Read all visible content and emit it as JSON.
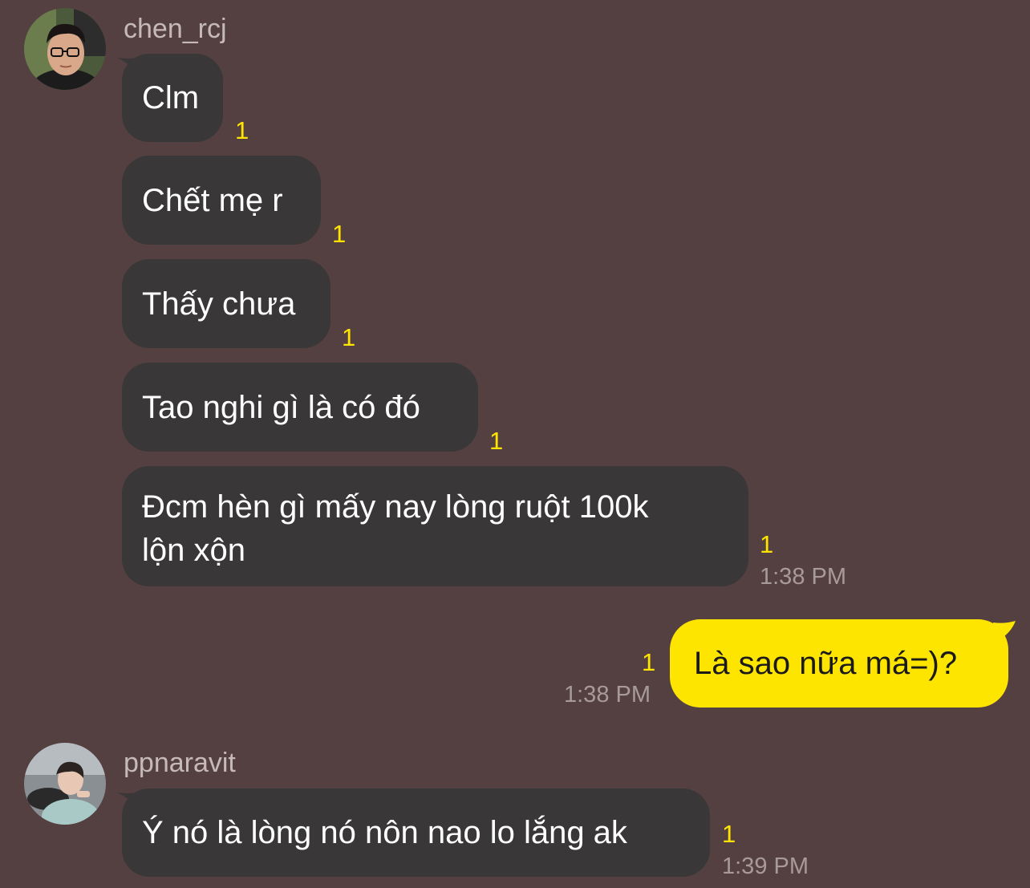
{
  "colors": {
    "background": "#544040",
    "incoming_bubble": "#393738",
    "outgoing_bubble": "#fee500",
    "unread_count": "#fee500"
  },
  "messages": {
    "group1": {
      "sender": "chen_rcj",
      "avatar_icon": "user-photo",
      "items": [
        {
          "text": "Clm",
          "unread": "1"
        },
        {
          "text": "Chết mẹ r",
          "unread": "1"
        },
        {
          "text": "Thấy chưa",
          "unread": "1"
        },
        {
          "text": "Tao nghi gì là có đó",
          "unread": "1"
        },
        {
          "text_line1": "Đcm hèn gì mấy nay lòng ruột 100k",
          "text_line2": "lộn xộn",
          "unread": "1",
          "time": "1:38 PM"
        }
      ]
    },
    "outgoing": {
      "text": "Là sao nữa má=)?",
      "unread": "1",
      "time": "1:38 PM"
    },
    "group2": {
      "sender": "ppnaravit",
      "avatar_icon": "user-photo",
      "text": "Ý nó là lòng nó nôn nao lo lắng ak",
      "unread": "1",
      "time": "1:39 PM"
    }
  }
}
